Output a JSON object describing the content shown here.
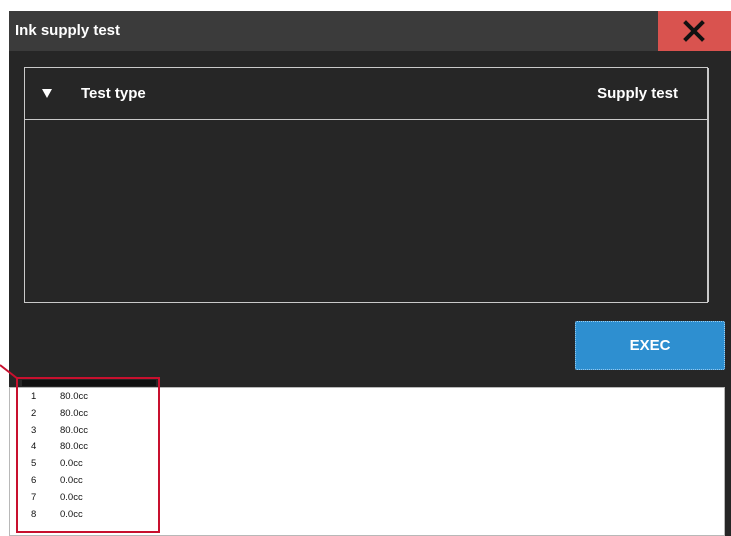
{
  "window": {
    "title": "Ink supply test"
  },
  "panel": {
    "label": "Test type",
    "value": "Supply test"
  },
  "buttons": {
    "exec": "EXEC"
  },
  "log": {
    "rows": [
      {
        "index": "1",
        "value": "80.0cc"
      },
      {
        "index": "2",
        "value": "80.0cc"
      },
      {
        "index": "3",
        "value": "80.0cc"
      },
      {
        "index": "4",
        "value": "80.0cc"
      },
      {
        "index": "5",
        "value": "0.0cc"
      },
      {
        "index": "6",
        "value": "0.0cc"
      },
      {
        "index": "7",
        "value": "0.0cc"
      },
      {
        "index": "8",
        "value": "0.0cc"
      }
    ]
  },
  "colors": {
    "title_bar": "#3b3b3b",
    "window_bg": "#262626",
    "close_button": "#d9534f",
    "exec_button": "#2e8fd0",
    "highlight": "#c8102e"
  },
  "icons": {
    "close": "close-icon",
    "dropdown": "caret-down-icon"
  }
}
